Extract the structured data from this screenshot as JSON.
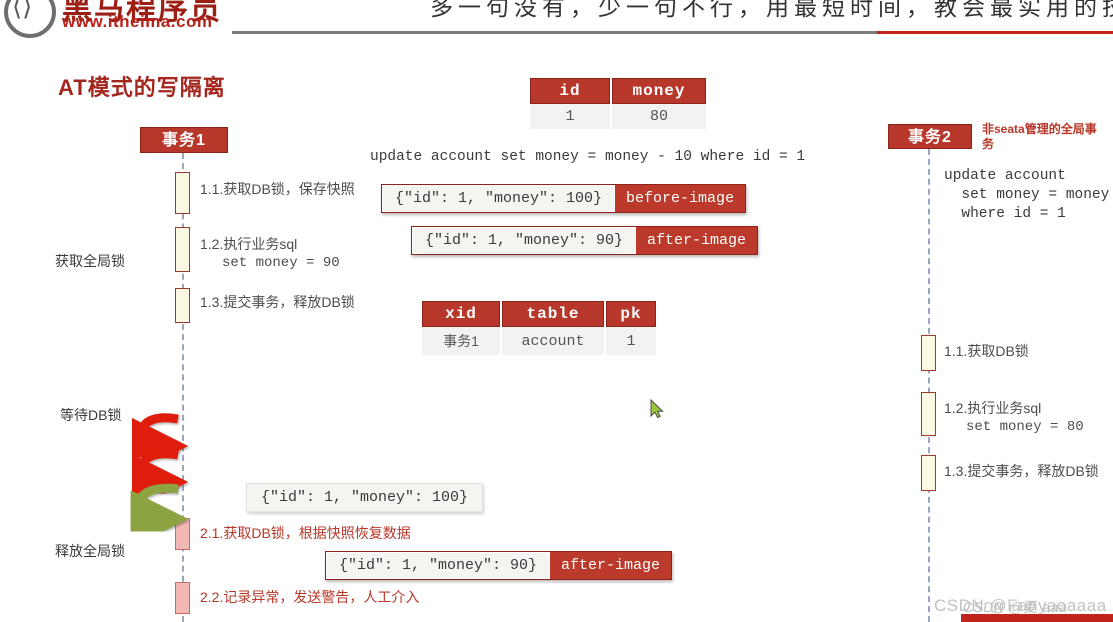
{
  "header": {
    "brand_cn": "黑马程序员",
    "brand_url": "www.itheima.com",
    "slogan": "多一句没有，少一句不行，用最短时间，教会最实用的技",
    "logo_glyph": "⟨⟩"
  },
  "page_title": "AT模式的写隔离",
  "account_table": {
    "headers": [
      "id",
      "money"
    ],
    "rows": [
      [
        "1",
        "80"
      ]
    ]
  },
  "lock_table": {
    "headers": [
      "xid",
      "table",
      "pk"
    ],
    "rows": [
      [
        "事务1",
        "account",
        "1"
      ]
    ]
  },
  "left": {
    "actor": "事务1",
    "sql": "update account set money = money - 10 where id = 1",
    "steps": [
      {
        "num": "1.1.",
        "text": "获取DB锁，保存快照",
        "sub": ""
      },
      {
        "num": "1.2.",
        "text": "执行业务sql",
        "sub": "set money = 90"
      },
      {
        "num": "1.3.",
        "text": "提交事务，释放DB锁",
        "sub": ""
      },
      {
        "num": "2.1.",
        "text": "获取DB锁，根据快照恢复数据",
        "sub": ""
      },
      {
        "num": "2.2.",
        "text": "记录异常，发送警告，人工介入",
        "sub": ""
      }
    ],
    "chips": [
      {
        "json": "{\"id\": 1, \"money\": 100}",
        "tag": "before-image"
      },
      {
        "json": "{\"id\": 1, \"money\": 90}",
        "tag": "after-image"
      },
      {
        "json": "{\"id\": 1, \"money\": 90}",
        "tag": "after-image"
      }
    ],
    "snapshot_box": "{\"id\": 1, \"money\": 100}",
    "arrows": [
      {
        "label": "获取全局锁"
      },
      {
        "label": "等待DB锁"
      },
      {
        "label": "释放全局锁"
      }
    ]
  },
  "right": {
    "actor": "事务2",
    "note": "非seata管理的全局事务",
    "sql": "update account\n  set money = money\n  where id = 1",
    "steps": [
      {
        "num": "1.1.",
        "text": "获取DB锁",
        "sub": ""
      },
      {
        "num": "1.2.",
        "text": "执行业务sql",
        "sub": "set money = 80"
      },
      {
        "num": "1.3.",
        "text": "提交事务，释放DB锁",
        "sub": ""
      }
    ]
  },
  "watermark": "CSDN @Fanyaoaaaa",
  "watermark_overlay": "CSDN @夏 aaa",
  "colors": {
    "brand_red": "#b7382a",
    "dark_red": "#8d2418",
    "title_red": "#a3271e",
    "activation_fill": "#fbf8e3",
    "activation_pink": "#f2b8b4",
    "arrow_green": "#8ba33f",
    "arrow_red": "#e01b08",
    "lifeline": "#9aa6bb"
  }
}
